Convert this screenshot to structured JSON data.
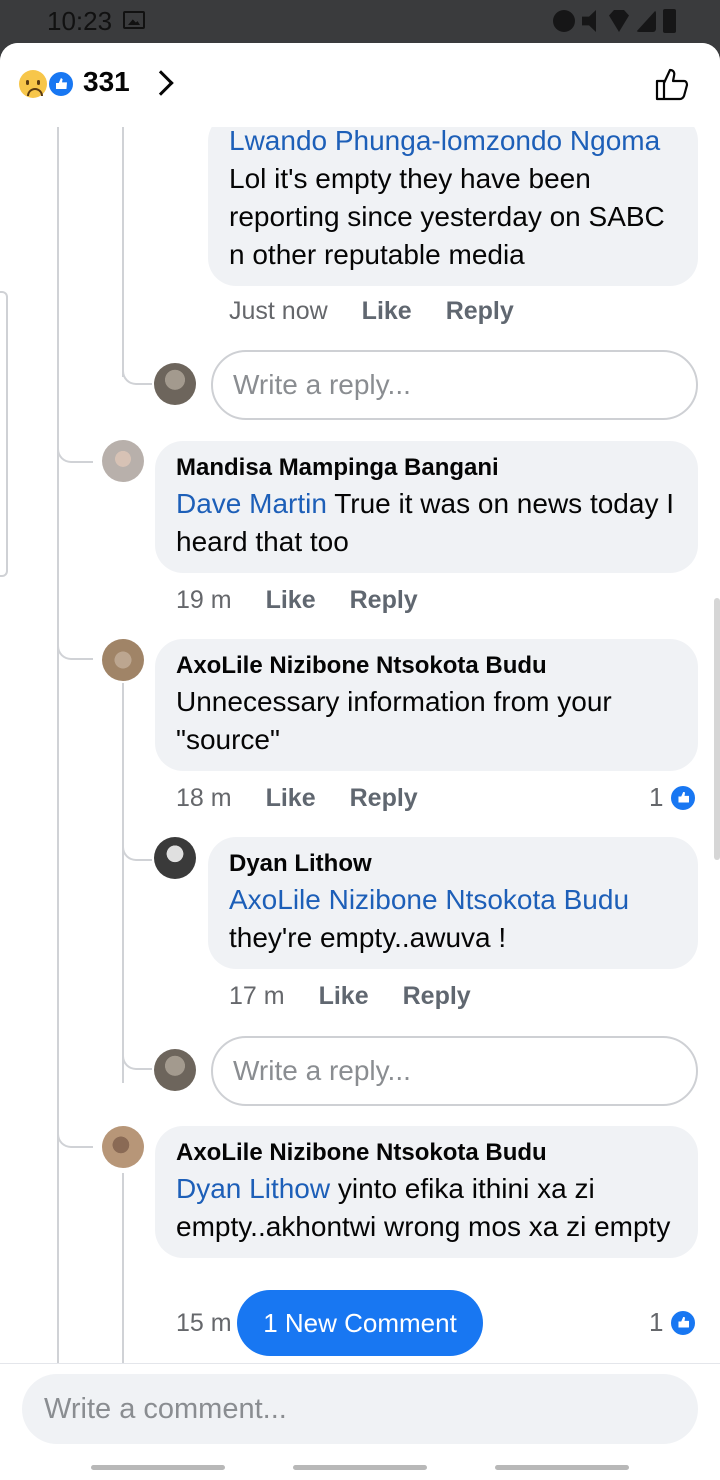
{
  "status_bar": {
    "time": "10:23"
  },
  "header": {
    "reaction_count": "331"
  },
  "comments": {
    "c1": {
      "mention": "Lwando Phunga-lomzondo Ngoma",
      "text": " Lol it's empty they have been reporting since yesterday on SABC n other reputable media",
      "time": "Just now",
      "like": "Like",
      "reply": "Reply"
    },
    "c2": {
      "name": "Mandisa Mampinga Bangani",
      "mention": "Dave Martin",
      "text": " True it was on news today I heard that too",
      "time": "19 m",
      "like": "Like",
      "reply": "Reply"
    },
    "c3": {
      "name": "AxoLile Nizibone Ntsokota Budu",
      "text": "Unnecessary information from your \"source\"",
      "time": "18 m",
      "like": "Like",
      "reply": "Reply",
      "likes": "1"
    },
    "c4": {
      "name": "Dyan Lithow",
      "mention": "AxoLile Nizibone Ntsokota Budu",
      "text": "they're empty..awuva !",
      "time": "17 m",
      "like": "Like",
      "reply": "Reply"
    },
    "c5": {
      "name": "AxoLile Nizibone Ntsokota Budu",
      "mention": "Dyan Lithow",
      "text": " yinto efika ithini xa zi empty..akhontwi wrong mos xa zi empty",
      "time": "15 m",
      "likes": "1"
    }
  },
  "reply_placeholder": "Write a reply...",
  "new_comment_label": "1 New Comment",
  "composer_placeholder": "Write a comment..."
}
